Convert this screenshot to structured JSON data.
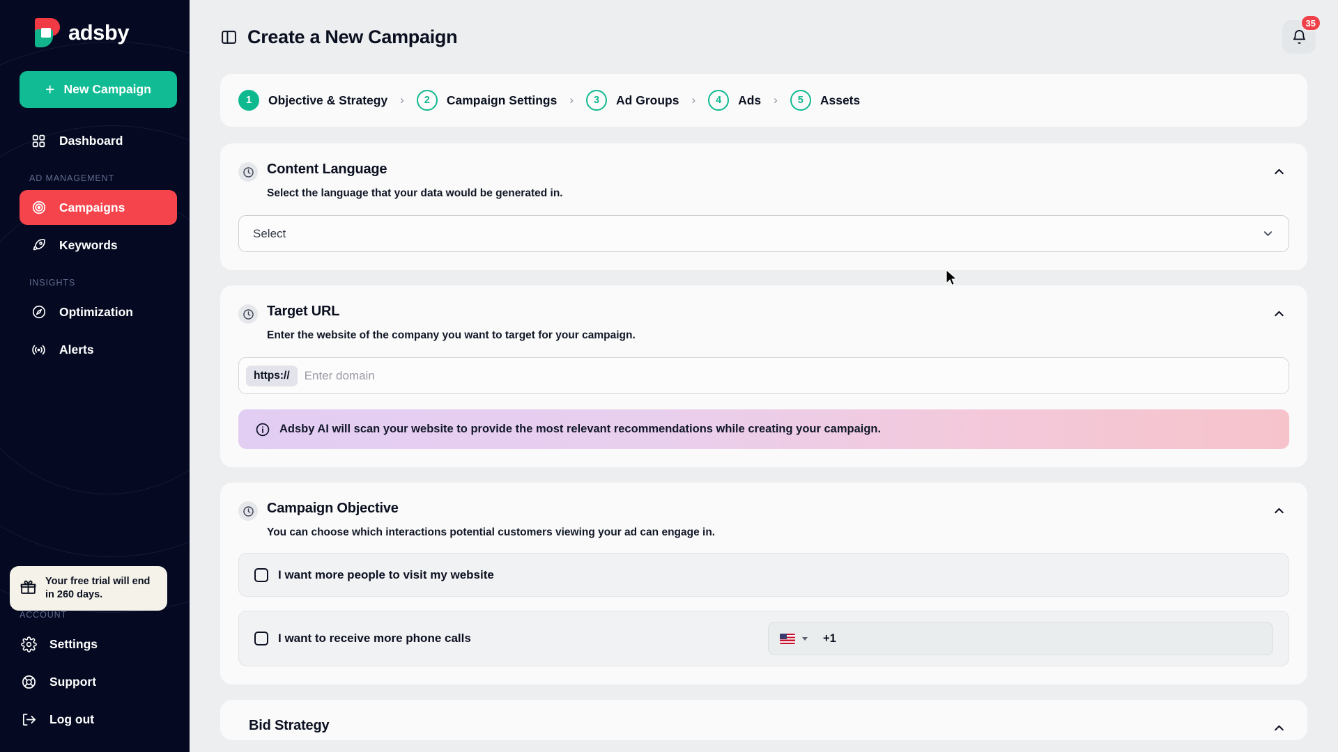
{
  "brand": {
    "name": "adsby",
    "logo_icon": "adsby-logo"
  },
  "sidebar": {
    "new_campaign_label": "New Campaign",
    "primary": [
      {
        "label": "Dashboard",
        "icon": "grid-icon"
      }
    ],
    "sections": [
      {
        "label": "AD MANAGEMENT",
        "items": [
          {
            "label": "Campaigns",
            "icon": "target-icon",
            "active": true
          },
          {
            "label": "Keywords",
            "icon": "rocket-icon",
            "active": false
          }
        ]
      },
      {
        "label": "INSIGHTS",
        "items": [
          {
            "label": "Optimization",
            "icon": "compass-icon",
            "active": false
          },
          {
            "label": "Alerts",
            "icon": "broadcast-icon",
            "active": false
          }
        ]
      }
    ],
    "trial": {
      "icon": "gift-icon",
      "text": "Your free trial will end in 260 days."
    },
    "account_label": "ACCOUNT",
    "account_items": [
      {
        "label": "Settings",
        "icon": "gear-icon"
      },
      {
        "label": "Support",
        "icon": "lifebuoy-icon"
      },
      {
        "label": "Log out",
        "icon": "logout-icon"
      }
    ]
  },
  "topbar": {
    "toggle_icon": "sidebar-panel-icon",
    "title": "Create a New Campaign",
    "bell_icon": "bell-icon",
    "notification_count": "35"
  },
  "stepper": {
    "steps": [
      {
        "num": "1",
        "label": "Objective & Strategy",
        "current": true
      },
      {
        "num": "2",
        "label": "Campaign Settings",
        "current": false
      },
      {
        "num": "3",
        "label": "Ad Groups",
        "current": false
      },
      {
        "num": "4",
        "label": "Ads",
        "current": false
      },
      {
        "num": "5",
        "label": "Assets",
        "current": false
      }
    ],
    "separator": "›"
  },
  "content_language": {
    "icon": "clock-icon",
    "title": "Content Language",
    "subtitle": "Select the language that your data would be generated in.",
    "collapse_icon": "chevron-up-icon",
    "select_value": "Select",
    "select_chevron": "chevron-down-icon"
  },
  "target_url": {
    "icon": "clock-icon",
    "title": "Target URL",
    "subtitle": "Enter the website of the company you want to target for your campaign.",
    "collapse_icon": "chevron-up-icon",
    "prefix": "https://",
    "input_value": "",
    "input_placeholder": "Enter domain",
    "banner": {
      "icon": "info-icon",
      "text": "Adsby AI will scan your website to provide the most relevant recommendations while creating your campaign."
    }
  },
  "campaign_objective": {
    "icon": "clock-icon",
    "title": "Campaign Objective",
    "subtitle": "You can choose which interactions potential customers viewing your ad can engage in.",
    "collapse_icon": "chevron-up-icon",
    "options": [
      {
        "label": "I want more people to visit my website",
        "checked": false
      },
      {
        "label": "I want to receive more phone calls",
        "checked": false
      }
    ],
    "phone": {
      "flag_icon": "us-flag-icon",
      "caret_icon": "caret-down-icon",
      "dial_code": "+1",
      "value": ""
    }
  },
  "bid_strategy": {
    "title": "Bid Strategy",
    "collapse_icon": "chevron-up-icon"
  },
  "colors": {
    "brand_teal": "#11BC94",
    "brand_red": "#F5444C",
    "sidebar_bg": "#050A22",
    "page_bg": "#ECEEF0",
    "card_bg": "#FAFAFA",
    "step_accent": "#0FB98F",
    "badge_red": "#F04049"
  }
}
